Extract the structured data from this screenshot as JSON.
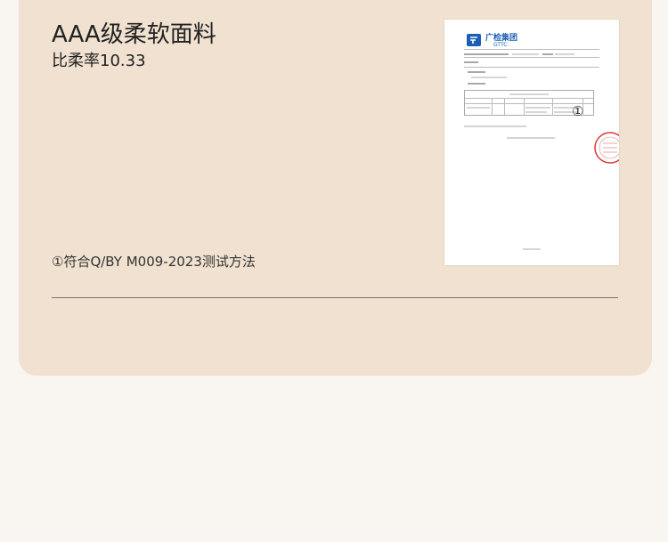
{
  "title": "AAA级柔软面料",
  "subtitle": "比柔率10.33",
  "footnote": "①符合Q/BY M009-2023测试方法",
  "report": {
    "logo_name": "广检集团",
    "logo_sub": "GTTC",
    "circle_mark": "①",
    "colors": {
      "logo_blue": "#1a5fb4",
      "stamp_red": "#d93a3a"
    }
  }
}
